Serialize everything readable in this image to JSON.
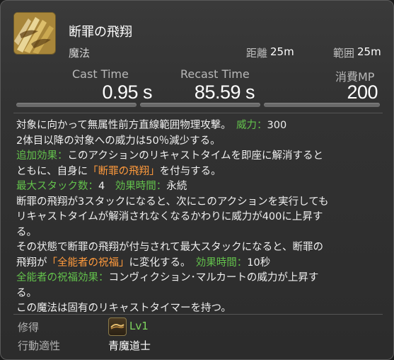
{
  "skill": {
    "name": "断罪の飛翔",
    "type": "魔法",
    "distance_label": "距離",
    "distance_value": "25m",
    "radius_label": "範囲",
    "radius_value": "25m",
    "icon": "judgment-wings-icon"
  },
  "stats": {
    "cast_label": "Cast Time",
    "cast_value": "0.95 s",
    "recast_label": "Recast Time",
    "recast_value": "85.59 s",
    "mp_label": "消費MP",
    "mp_value": "200"
  },
  "description": {
    "l1_text": "対象に向かって無属性前方直線範囲物理攻撃。",
    "l1_potency_label": "威力：",
    "l1_potency_value": "300",
    "l2_text": "2体目以降の対象への威力は50％減少する。",
    "l3_label": "追加効果：",
    "l3_text": "このアクションのリキャストタイムを即座に解消すると",
    "l4_text_a": "ともに、自身に",
    "l4_status": "「断罪の飛翔」",
    "l4_text_b": "を付与する。",
    "l5_stack_label": "最大スタック数：",
    "l5_stack_value": "4",
    "l5_duration_label": "効果時間：",
    "l5_duration_value": "永続",
    "l6_text": "断罪の飛翔が3スタックになると、次にこのアクションを実行しても",
    "l7_text": "リキャストタイムが解消されなくなるかわりに威力が400に上昇す",
    "l8_text": "る。",
    "l9_text": "その状態で断罪の飛翔が付与されて最大スタックになると、断罪の",
    "l10_text_a": "飛翔が",
    "l10_status": "「全能者の祝福」",
    "l10_text_b": "に変化する。",
    "l10_duration_label": "効果時間：",
    "l10_duration_value": "10秒",
    "l11_label": "全能者の祝福効果：",
    "l11_text": "コンヴィクション･マルカートの威力が上昇す",
    "l12_text": "る。",
    "l13_text": "この魔法は固有のリキャストタイマーを持つ。"
  },
  "meta": {
    "acquired_label": "修得",
    "acquired_icon": "blue-mage-job-icon",
    "acquired_value": "Lv1",
    "class_label": "行動適性",
    "class_value": "青魔道士"
  },
  "colors": {
    "effect_green": "#63c24c",
    "status_orange": "#ff9a3c",
    "level_green": "#7dd45e"
  }
}
